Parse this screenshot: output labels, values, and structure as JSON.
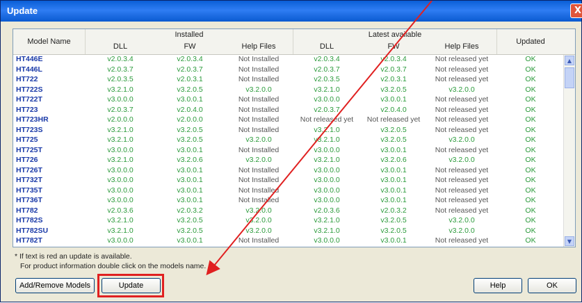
{
  "window": {
    "title": "Update",
    "close_glyph": "X"
  },
  "header": {
    "model_name": "Model Name",
    "installed_group": "Installed",
    "latest_group": "Latest available",
    "dll": "DLL",
    "fw": "FW",
    "help_files": "Help Files",
    "updated": "Updated"
  },
  "rows": [
    {
      "name": "HT446E",
      "idll": "v2.0.3.4",
      "ifw": "v2.0.3.4",
      "ihelp": "Not Installed",
      "ldll": "v2.0.3.4",
      "lfw": "v2.0.3.4",
      "lhelp": "Not released yet",
      "upd": "OK"
    },
    {
      "name": "HT446L",
      "idll": "v2.0.3.7",
      "ifw": "v2.0.3.7",
      "ihelp": "Not Installed",
      "ldll": "v2.0.3.7",
      "lfw": "v2.0.3.7",
      "lhelp": "Not released yet",
      "upd": "OK"
    },
    {
      "name": "HT722",
      "idll": "v2.0.3.5",
      "ifw": "v2.0.3.1",
      "ihelp": "Not Installed",
      "ldll": "v2.0.3.5",
      "lfw": "v2.0.3.1",
      "lhelp": "Not released yet",
      "upd": "OK"
    },
    {
      "name": "HT722S",
      "idll": "v3.2.1.0",
      "ifw": "v3.2.0.5",
      "ihelp": "v3.2.0.0",
      "ldll": "v3.2.1.0",
      "lfw": "v3.2.0.5",
      "lhelp": "v3.2.0.0",
      "upd": "OK"
    },
    {
      "name": "HT722T",
      "idll": "v3.0.0.0",
      "ifw": "v3.0.0.1",
      "ihelp": "Not Installed",
      "ldll": "v3.0.0.0",
      "lfw": "v3.0.0.1",
      "lhelp": "Not released yet",
      "upd": "OK"
    },
    {
      "name": "HT723",
      "idll": "v2.0.3.7",
      "ifw": "v2.0.4.0",
      "ihelp": "Not Installed",
      "ldll": "v2.0.3.7",
      "lfw": "v2.0.4.0",
      "lhelp": "Not released yet",
      "upd": "OK"
    },
    {
      "name": "HT723HR",
      "idll": "v2.0.0.0",
      "ifw": "v2.0.0.0",
      "ihelp": "Not Installed",
      "ldll": "Not released yet",
      "lfw": "Not released yet",
      "lhelp": "Not released yet",
      "upd": "OK"
    },
    {
      "name": "HT723S",
      "idll": "v3.2.1.0",
      "ifw": "v3.2.0.5",
      "ihelp": "Not Installed",
      "ldll": "v3.2.1.0",
      "lfw": "v3.2.0.5",
      "lhelp": "Not released yet",
      "upd": "OK"
    },
    {
      "name": "HT725",
      "idll": "v3.2.1.0",
      "ifw": "v3.2.0.5",
      "ihelp": "v3.2.0.0",
      "ldll": "v3.2.1.0",
      "lfw": "v3.2.0.5",
      "lhelp": "v3.2.0.0",
      "upd": "OK"
    },
    {
      "name": "HT725T",
      "idll": "v3.0.0.0",
      "ifw": "v3.0.0.1",
      "ihelp": "Not Installed",
      "ldll": "v3.0.0.0",
      "lfw": "v3.0.0.1",
      "lhelp": "Not released yet",
      "upd": "OK"
    },
    {
      "name": "HT726",
      "idll": "v3.2.1.0",
      "ifw": "v3.2.0.6",
      "ihelp": "v3.2.0.0",
      "ldll": "v3.2.1.0",
      "lfw": "v3.2.0.6",
      "lhelp": "v3.2.0.0",
      "upd": "OK"
    },
    {
      "name": "HT726T",
      "idll": "v3.0.0.0",
      "ifw": "v3.0.0.1",
      "ihelp": "Not Installed",
      "ldll": "v3.0.0.0",
      "lfw": "v3.0.0.1",
      "lhelp": "Not released yet",
      "upd": "OK"
    },
    {
      "name": "HT732T",
      "idll": "v3.0.0.0",
      "ifw": "v3.0.0.1",
      "ihelp": "Not Installed",
      "ldll": "v3.0.0.0",
      "lfw": "v3.0.0.1",
      "lhelp": "Not released yet",
      "upd": "OK"
    },
    {
      "name": "HT735T",
      "idll": "v3.0.0.0",
      "ifw": "v3.0.0.1",
      "ihelp": "Not Installed",
      "ldll": "v3.0.0.0",
      "lfw": "v3.0.0.1",
      "lhelp": "Not released yet",
      "upd": "OK"
    },
    {
      "name": "HT736T",
      "idll": "v3.0.0.0",
      "ifw": "v3.0.0.1",
      "ihelp": "Not Installed",
      "ldll": "v3.0.0.0",
      "lfw": "v3.0.0.1",
      "lhelp": "Not released yet",
      "upd": "OK"
    },
    {
      "name": "HT782",
      "idll": "v2.0.3.6",
      "ifw": "v2.0.3.2",
      "ihelp": "v3.2.0.0",
      "ldll": "v2.0.3.6",
      "lfw": "v2.0.3.2",
      "lhelp": "Not released yet",
      "upd": "OK"
    },
    {
      "name": "HT782S",
      "idll": "v3.2.1.0",
      "ifw": "v3.2.0.5",
      "ihelp": "v3.2.0.0",
      "ldll": "v3.2.1.0",
      "lfw": "v3.2.0.5",
      "lhelp": "v3.2.0.0",
      "upd": "OK"
    },
    {
      "name": "HT782SU",
      "idll": "v3.2.1.0",
      "ifw": "v3.2.0.5",
      "ihelp": "v3.2.0.0",
      "ldll": "v3.2.1.0",
      "lfw": "v3.2.0.5",
      "lhelp": "v3.2.0.0",
      "upd": "OK"
    },
    {
      "name": "HT782T",
      "idll": "v3.0.0.0",
      "ifw": "v3.0.0.1",
      "ihelp": "Not Installed",
      "ldll": "v3.0.0.0",
      "lfw": "v3.0.0.1",
      "lhelp": "Not released yet",
      "upd": "OK"
    }
  ],
  "notes": {
    "line1": "* If text is red an update is available.",
    "line2": "For product information double click on the models name."
  },
  "buttons": {
    "add_remove": "Add/Remove Models",
    "update": "Update",
    "help": "Help",
    "ok": "OK"
  },
  "colors": {
    "value_green": "#2a9a3a",
    "model_blue": "#1a3aa8",
    "annotation_red": "#e02020"
  }
}
